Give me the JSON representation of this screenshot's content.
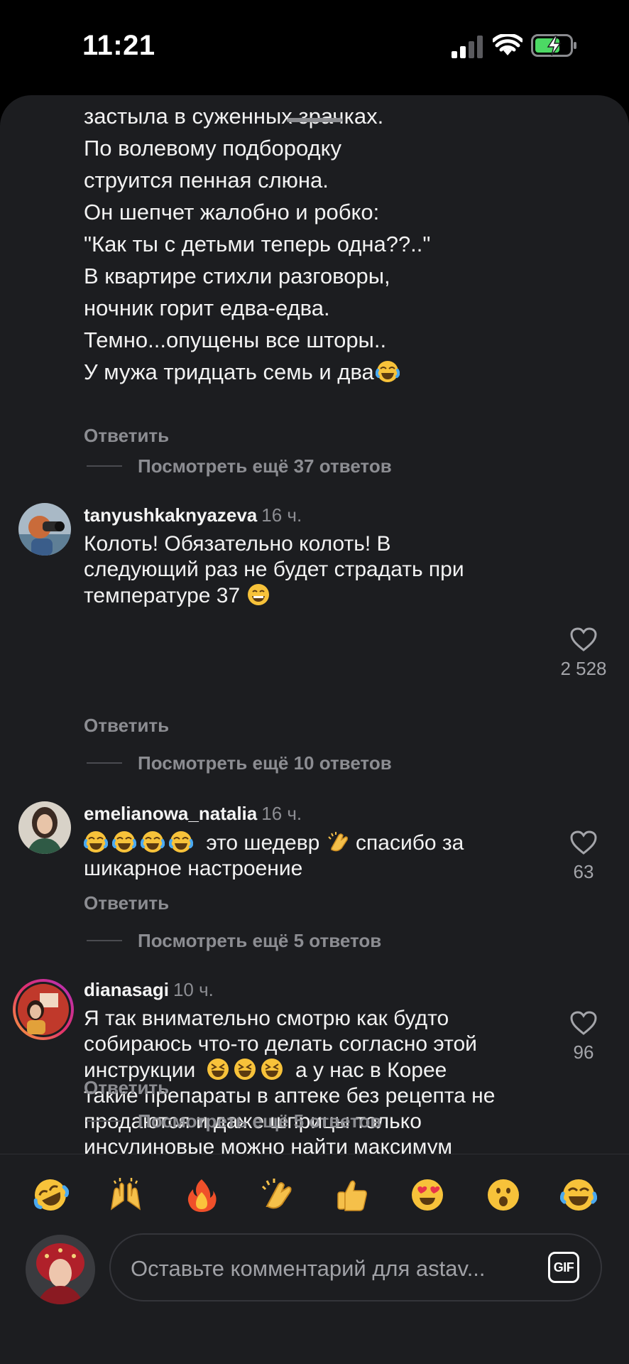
{
  "status_bar": {
    "time": "11:21"
  },
  "thread": {
    "poem_lines": [
      "застыла в суженных зрачках.",
      "По волевому подбородку",
      "струится пенная слюна.",
      "Он шепчет жалобно и робко:",
      "\"Как ты с детьми теперь одна??..\"",
      "В квартире стихли разговоры,",
      "ночник горит едва-едва.",
      "Темно...опущены все шторы..",
      "У мужа тридцать семь и два"
    ],
    "poem_reply": "Ответить",
    "poem_more": "Посмотреть ещё 37 ответов"
  },
  "comments": [
    {
      "user": "tanyushkaknyazeva",
      "time": "16 ч.",
      "lines": [
        "Колоть! Обязательно колоть! В",
        "следующий раз не будет страдать при",
        "температуре 37"
      ],
      "likes": "2 528",
      "reply": "Ответить",
      "more": "Посмотреть ещё 10 ответов"
    },
    {
      "user": "emelianowa_natalia",
      "time": "16 ч.",
      "line1_a": "это шедевр",
      "line1_b": "спасибо за",
      "line2": "шикарное настроение",
      "likes": "63",
      "reply": "Ответить",
      "more": "Посмотреть ещё 5 ответов"
    },
    {
      "user": "dianasagi",
      "time": "10 ч.",
      "line1": "Я так внимательно смотрю как будто",
      "line2": "собираюсь что-то делать согласно этой",
      "line3_a": "инструкции",
      "line3_b": "а у нас в Корее",
      "line4": "такие препараты в аптеке без рецепта не",
      "line5": "продаются и даже шприцы только",
      "line6": "инсулиновые можно найти максимум",
      "likes": "96",
      "reply": "Ответить",
      "more": "Посмотреть ещё 5 ответов"
    }
  ],
  "reactions": [
    "rofl-emoji",
    "raising-hands-emoji",
    "fire-emoji",
    "clapping-emoji",
    "thumbs-up-emoji",
    "heart-eyes-emoji",
    "surprised-emoji",
    "joy-emoji"
  ],
  "composer": {
    "placeholder": "Оставьте комментарий для astav...",
    "gif_label": "GIF"
  },
  "colors": {
    "sheet": "#1c1d20",
    "muted": "#8c8d92",
    "battery": "#4cd964",
    "story_ring": "#e1306c"
  }
}
